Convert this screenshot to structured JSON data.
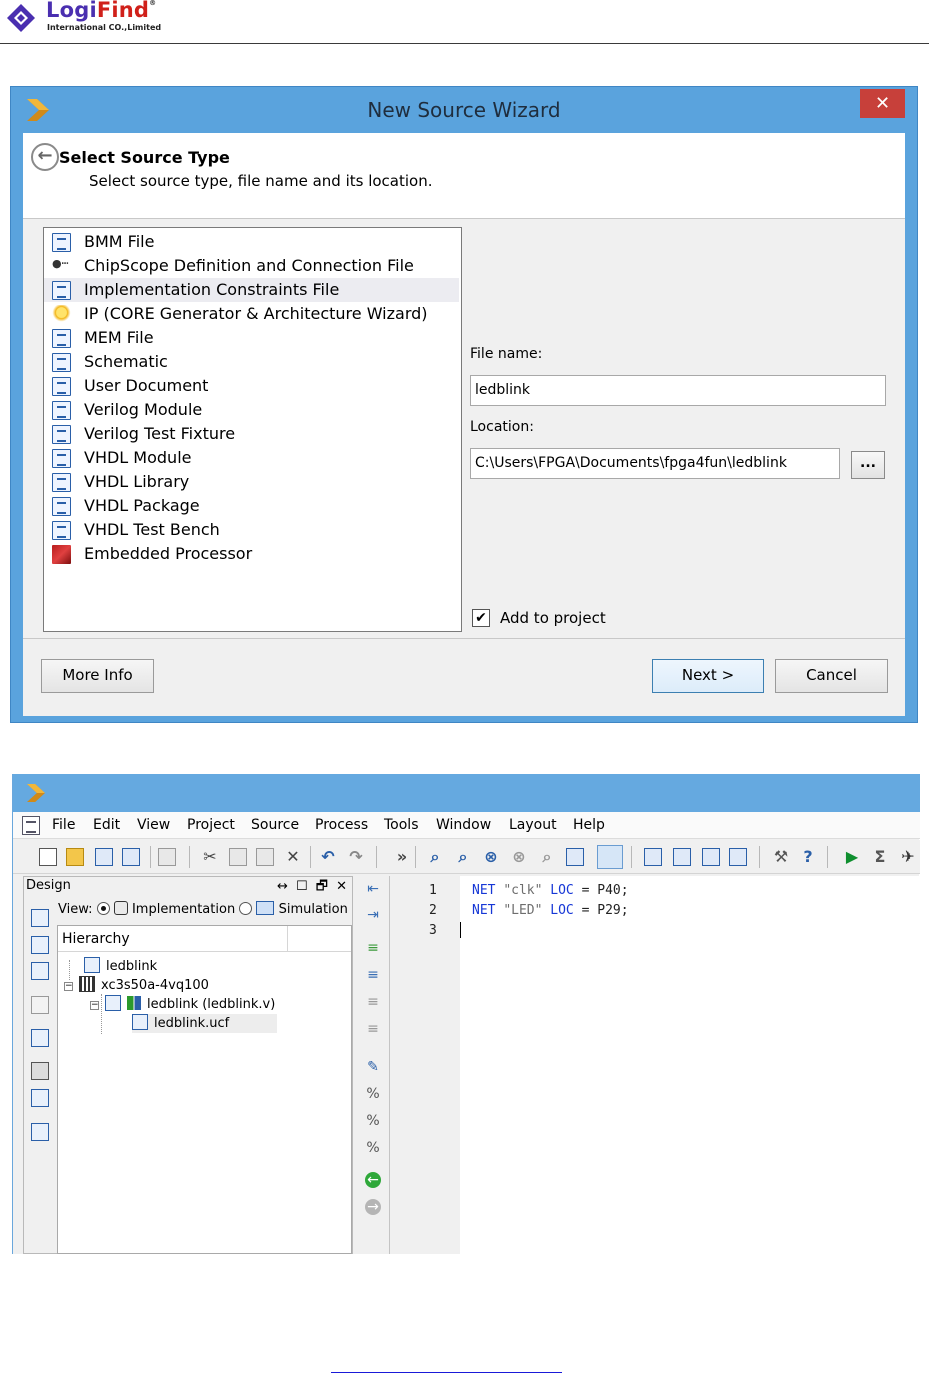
{
  "header": {
    "brand_logi": "Logi",
    "brand_find": "Find",
    "brand_reg": "®",
    "brand_sub": "International CO.,Limited"
  },
  "wizard": {
    "title": "New Source Wizard",
    "close_glyph": "✕",
    "back_glyph": "←",
    "heading": "Select Source Type",
    "subheading": "Select source type, file name and its location.",
    "source_types": [
      {
        "label": "BMM File",
        "icon": "bmm-file-icon"
      },
      {
        "label": "ChipScope Definition and Connection File",
        "icon": "chipscope-icon"
      },
      {
        "label": "Implementation Constraints File",
        "icon": "ucf-file-icon",
        "selected": true
      },
      {
        "label": "IP (CORE Generator & Architecture Wizard)",
        "icon": "ip-bulb-icon"
      },
      {
        "label": "MEM File",
        "icon": "mem-file-icon"
      },
      {
        "label": "Schematic",
        "icon": "schematic-icon"
      },
      {
        "label": "User Document",
        "icon": "document-icon"
      },
      {
        "label": "Verilog Module",
        "icon": "verilog-icon"
      },
      {
        "label": "Verilog Test Fixture",
        "icon": "verilog-test-icon"
      },
      {
        "label": "VHDL Module",
        "icon": "vhdl-module-icon"
      },
      {
        "label": "VHDL Library",
        "icon": "vhdl-library-icon"
      },
      {
        "label": "VHDL Package",
        "icon": "vhdl-package-icon"
      },
      {
        "label": "VHDL Test Bench",
        "icon": "vhdl-testbench-icon"
      },
      {
        "label": "Embedded Processor",
        "icon": "embedded-processor-icon"
      }
    ],
    "file_name_label": "File name:",
    "file_name_value": "ledblink",
    "location_label": "Location:",
    "location_value": "C:\\Users\\FPGA\\Documents\\fpga4fun\\ledblink",
    "browse_label": "...",
    "add_to_project_label": "Add to project",
    "add_to_project_checked": "✔",
    "more_info_label": "More Info",
    "next_label": "Next >",
    "cancel_label": "Cancel"
  },
  "ise": {
    "menu": [
      "File",
      "Edit",
      "View",
      "Project",
      "Source",
      "Process",
      "Tools",
      "Window",
      "Layout",
      "Help"
    ],
    "toolbar_overflow": "»",
    "design_panel": {
      "title": "Design",
      "controls": "↔ ☐ 🗗 ✕",
      "view_label": "View:",
      "view_implementation": "Implementation",
      "view_simulation": "Simulation",
      "hierarchy_label": "Hierarchy",
      "tree": [
        "ledblink",
        "xc3s50a-4vq100",
        "ledblink (ledblink.v)",
        "ledblink.ucf"
      ],
      "expand_glyph": "−"
    },
    "editor": {
      "line_numbers": [
        "1",
        "2",
        "3"
      ],
      "lines": [
        {
          "kw1": "NET",
          "str": "\"clk\"",
          "kw2": "LOC",
          "rest": " = P40;"
        },
        {
          "kw1": "NET",
          "str": "\"LED\"",
          "kw2": "LOC",
          "rest": " = P29;"
        }
      ]
    }
  },
  "colors": {
    "title_blue": "#5aa3dd",
    "close_red": "#c7403a",
    "keyword_blue": "#1637d6",
    "brand_purple": "#4a2fb0",
    "brand_red": "#d0201a"
  }
}
